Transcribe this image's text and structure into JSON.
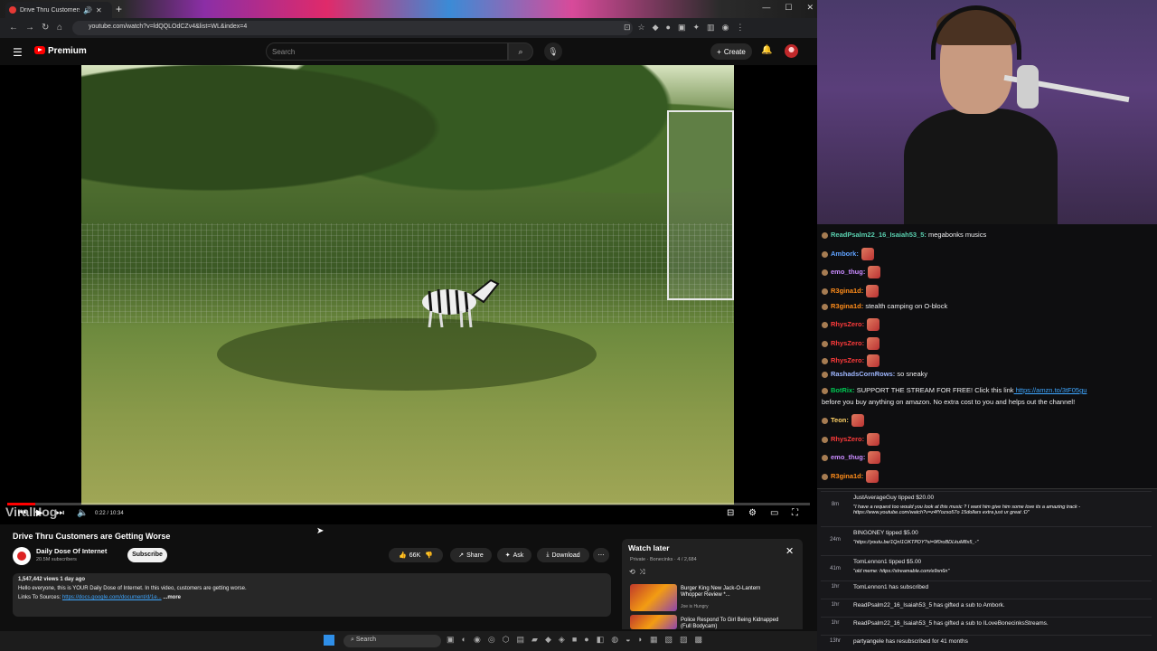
{
  "browser": {
    "tab_title": "Drive Thru Customers are G",
    "url": "youtube.com/watch?v=ldQQLOdCZv4&list=WL&index=4"
  },
  "youtube": {
    "brand": "Premium",
    "search_placeholder": "Search",
    "create_label": "Create"
  },
  "player": {
    "time": "0:22 / 10:34",
    "progress": 0.035,
    "watermark": "ViralHog"
  },
  "video": {
    "title": "Drive Thru Customers are Getting Worse",
    "channel": "Daily Dose Of Internet",
    "subscribers": "20.5M subscribers",
    "subscribe_label": "Subscribe",
    "likes": "66K",
    "share_label": "Share",
    "ask_label": "Ask",
    "download_label": "Download",
    "views": "1,547,442 views  1 day ago",
    "description": "Hello everyone, this is YOUR Daily Dose of Internet. In this video, customers are getting worse.",
    "links_label": "Links To Sources:",
    "links_url": "https://docs.google.com/document/d/1e...",
    "more_label": "...more"
  },
  "watch_later": {
    "title": "Watch later",
    "meta": "Private · Bonecinks · 4 / 2,684",
    "items": [
      {
        "title": "Burger King New Jack-O-Lantern Whopper Review *...",
        "channel": "Joe is Hungry",
        "duration": "10:59"
      },
      {
        "title": "Police Respond To Girl Being Kidnapped (Full Bodycam)",
        "channel": "",
        "duration": ""
      }
    ]
  },
  "taskbar": {
    "search": "Search"
  },
  "chat": [
    {
      "user": "ReadPsalm22_16_Isaiah53_5:",
      "msg": "megabonks musics",
      "color": "#5ad1b0"
    },
    {
      "user": "Ambork:",
      "msg": "",
      "color": "#5fa2ff"
    },
    {
      "user": "emo_thug:",
      "msg": "",
      "color": "#c98bff"
    },
    {
      "user": "R3gina1d:",
      "msg": "",
      "color": "#ff8c1a"
    },
    {
      "user": "R3gina1d:",
      "msg": "stealth camping on O-block",
      "color": "#ff8c1a"
    },
    {
      "user": "RhysZero:",
      "msg": "",
      "color": "#ff3b3b"
    },
    {
      "user": "RhysZero:",
      "msg": "",
      "color": "#ff3b3b"
    },
    {
      "user": "RhysZero:",
      "msg": "",
      "color": "#ff3b3b"
    },
    {
      "user": "RashadsCornRows:",
      "msg": "so sneaky",
      "color": "#9fb7ff"
    },
    {
      "user": "BotRix:",
      "msg": "SUPPORT THE STREAM FOR FREE! Click this link",
      "link": "https://amzn.to/3tF05gu",
      "msg2": "before you buy anything on amazon. No extra cost to you and helps out the channel!",
      "color": "#00c853"
    },
    {
      "user": "Teon:",
      "msg": "",
      "color": "#ffd166"
    },
    {
      "user": "RhysZero:",
      "msg": "",
      "color": "#ff3b3b"
    },
    {
      "user": "emo_thug:",
      "msg": "",
      "color": "#c98bff"
    },
    {
      "user": "R3gina1d:",
      "msg": "",
      "color": "#ff8c1a"
    }
  ],
  "feed": [
    {
      "time": "8m",
      "text": "JustAverageGuy tipped $20.00",
      "msg": "\"I have a request too would you look at this music ? I want him give him some love its a amazing track - https://www.youtube.com/watch?v=z4fYozso57o 15dollars extra just ur great :D\""
    },
    {
      "time": "24m",
      "text": "BINGONEY tipped $5.00",
      "msg": "\"https://youtu.be/1QnI1OKTPDY?si=9f0roBDLkuM8x5_-\""
    },
    {
      "time": "41m",
      "text": "TomLennon1 tipped $5.00",
      "msg": "\"old meme: https://streamable.com/e9sn6n\""
    },
    {
      "time": "1hr",
      "text": "TomLennon1 has subscribed",
      "msg": ""
    },
    {
      "time": "1hr",
      "text": "ReadPsalm22_16_Isaiah53_5 has gifted a sub to Ambork.",
      "msg": ""
    },
    {
      "time": "1hr",
      "text": "ReadPsalm22_16_Isaiah53_5 has gifted a sub to ILoveBonecinksStreams.",
      "msg": ""
    },
    {
      "time": "13hr",
      "text": "partyangele has resubscribed for 41 months",
      "msg": ""
    }
  ]
}
